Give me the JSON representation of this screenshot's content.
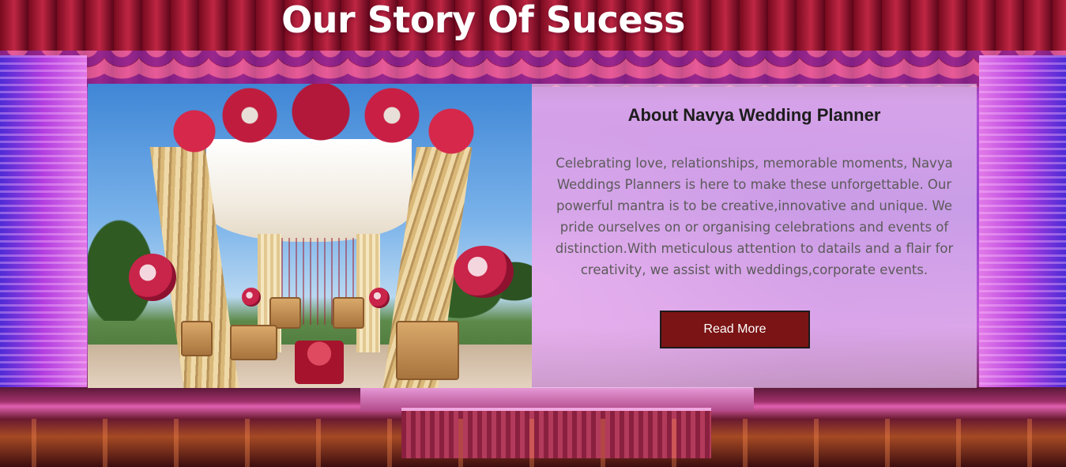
{
  "section": {
    "title": "Our Story Of Sucess"
  },
  "about": {
    "heading": "About Navya Wedding Planner",
    "text": "Celebrating love, relationships, memorable moments, Navya Weddings Planners is here to make these unforgettable. Our powerful mantra is to be creative,innovative and unique. We pride ourselves on or organising celebrations and events of distinction.With meticulous attention to datails and a flair for creativity, we assist with weddings,corporate events.",
    "button_label": "Read More"
  },
  "colors": {
    "button_bg": "#7b1414",
    "title_text": "#ffffff",
    "heading_text": "#1d1d1d",
    "body_text": "#5c5a5a"
  }
}
